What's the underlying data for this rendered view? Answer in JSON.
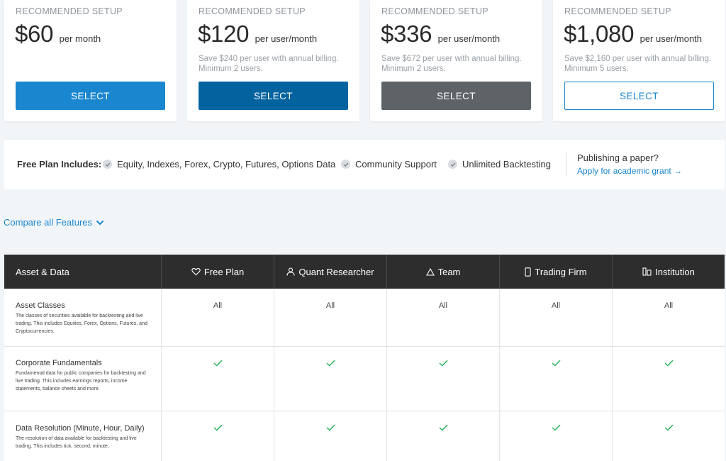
{
  "cards": [
    {
      "tag": "RECOMMENDED SETUP",
      "amount": "$60",
      "per": "per month",
      "note": "",
      "button": "SELECT"
    },
    {
      "tag": "RECOMMENDED SETUP",
      "amount": "$120",
      "per": "per user/month",
      "note": "Save $240 per user with annual billing. Minimum 2 users.",
      "button": "SELECT"
    },
    {
      "tag": "RECOMMENDED SETUP",
      "amount": "$336",
      "per": "per user/month",
      "note": "Save $672 per user with annual billing. Minimum 2 users.",
      "button": "SELECT"
    },
    {
      "tag": "RECOMMENDED SETUP",
      "amount": "$1,080",
      "per": "per user/month",
      "note": "Save $2,160 per user with annual billing. Minimum 5 users.",
      "button": "SELECT"
    }
  ],
  "free_plan": {
    "label": "Free Plan Includes:",
    "items": [
      "Equity, Indexes, Forex, Crypto, Futures, Options Data",
      "Community Support",
      "Unlimited Backtesting"
    ],
    "publish_question": "Publishing a paper?",
    "publish_link": "Apply for academic grant →"
  },
  "compare_label": "Compare all Features",
  "table": {
    "section": "Asset & Data",
    "columns": [
      {
        "label": "Free Plan",
        "icon": "heart-icon"
      },
      {
        "label": "Quant Researcher",
        "icon": "user-icon"
      },
      {
        "label": "Team",
        "icon": "triangle-icon"
      },
      {
        "label": "Trading Firm",
        "icon": "phone-icon"
      },
      {
        "label": "Institution",
        "icon": "building-icon"
      }
    ],
    "rows": [
      {
        "title": "Asset Classes",
        "desc": "The classes of securities available for backtesting and live trading. This includes Equities, Forex, Options, Futures, and Cryptocurrencies.",
        "values": [
          "All",
          "All",
          "All",
          "All",
          "All"
        ]
      },
      {
        "title": "Corporate Fundamentals",
        "desc": "Fundamental data for public companies for backtesting and live trading. This includes earnings reports, income statements, balance sheets and more.",
        "values": [
          "check",
          "check",
          "check",
          "check",
          "check"
        ]
      },
      {
        "title": "Data Resolution (Minute, Hour, Daily)",
        "desc": "The resolution of data available for backtesting and live trading. This includes tick, second, minute,",
        "values": [
          "check",
          "check",
          "check",
          "check",
          "check"
        ]
      }
    ]
  },
  "colors": {
    "accent": "#1a86cf",
    "dark_blue": "#03639f",
    "gray_button": "#5d6366",
    "header_bg": "#2d2d2d",
    "check_green": "#2bb35a"
  }
}
